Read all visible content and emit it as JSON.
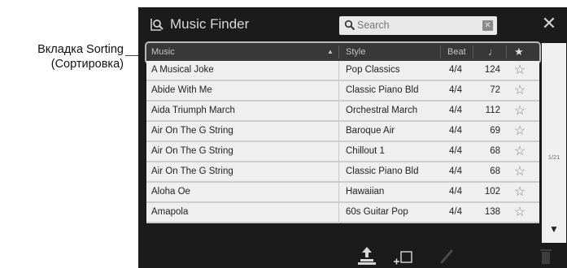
{
  "callout": {
    "line1": "Вкладка Sorting",
    "line2": "(Сортировка)"
  },
  "header": {
    "title": "Music Finder",
    "search_placeholder": "Search",
    "clear_glyph": "✕",
    "close_glyph": "✕"
  },
  "columns": {
    "music": "Music",
    "sort_arrow": "▲",
    "style": "Style",
    "beat": "Beat",
    "tempo": "♩",
    "favorite": "★"
  },
  "rows": [
    {
      "music": "A Musical Joke",
      "style": "Pop Classics",
      "beat": "4/4",
      "tempo": "124",
      "fav": "☆"
    },
    {
      "music": "Abide With Me",
      "style": "Classic Piano Bld",
      "beat": "4/4",
      "tempo": "72",
      "fav": "☆"
    },
    {
      "music": "Aida Triumph March",
      "style": "Orchestral March",
      "beat": "4/4",
      "tempo": "112",
      "fav": "☆"
    },
    {
      "music": "Air On The G String",
      "style": "Baroque Air",
      "beat": "4/4",
      "tempo": "69",
      "fav": "☆"
    },
    {
      "music": "Air On The G String",
      "style": "Chillout 1",
      "beat": "4/4",
      "tempo": "68",
      "fav": "☆"
    },
    {
      "music": "Air On The G String",
      "style": "Classic Piano Bld",
      "beat": "4/4",
      "tempo": "68",
      "fav": "☆"
    },
    {
      "music": "Aloha Oe",
      "style": "Hawaiian",
      "beat": "4/4",
      "tempo": "102",
      "fav": "☆"
    },
    {
      "music": "Amapola",
      "style": "60s Guitar Pop",
      "beat": "4/4",
      "tempo": "138",
      "fav": "☆"
    }
  ],
  "scroll": {
    "page": "1/21",
    "down_glyph": "▼"
  },
  "toolbar": {
    "icons": [
      "upload-icon",
      "add-icon",
      "edit-icon",
      "delete-icon"
    ]
  }
}
